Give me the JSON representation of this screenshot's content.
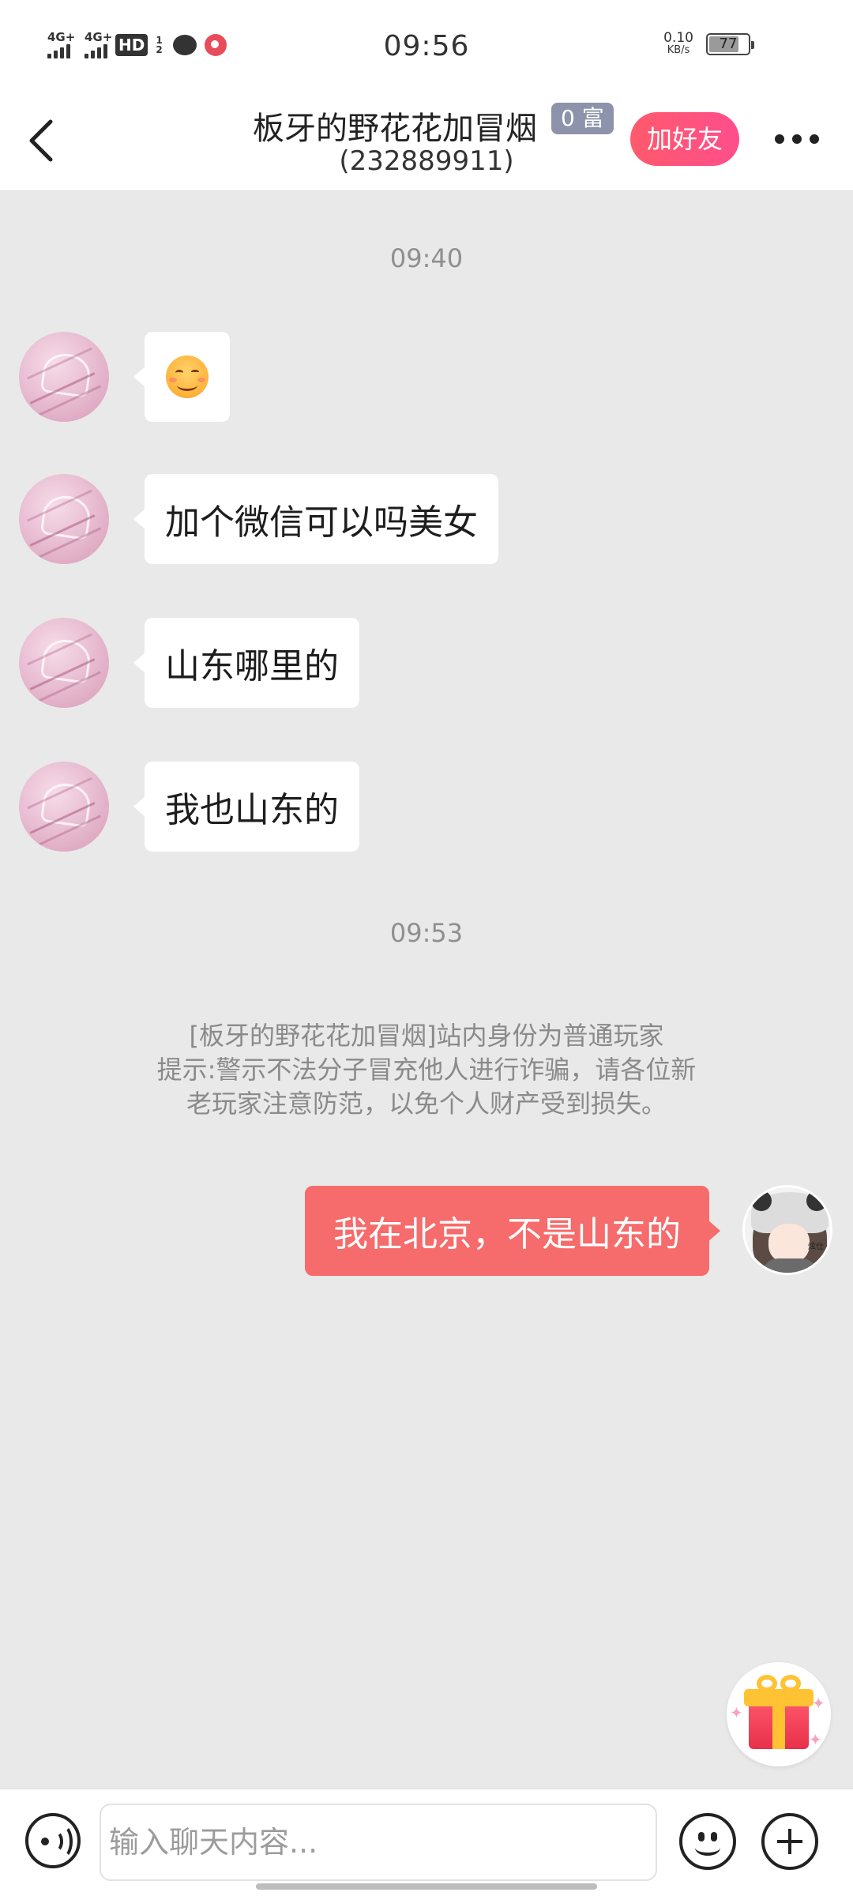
{
  "status_bar": {
    "time": "09:56",
    "network_1": "4G+",
    "network_2": "4G+",
    "hd_label": "HD",
    "hd_sub": "1 2",
    "speed_value": "0.10",
    "speed_unit": "KB/s",
    "battery": "77",
    "icons": [
      "signal-icon",
      "signal-icon",
      "hd-icon",
      "message-icon",
      "app-notification-icon",
      "battery-icon"
    ]
  },
  "header": {
    "title": "板牙的野花花加冒烟",
    "subtitle": "(232889911)",
    "badge": "0 富",
    "add_friend": "加好友",
    "back_icon": "back-arrow-icon",
    "more_icon": "more-dots-icon"
  },
  "chat": {
    "timestamps": [
      "09:40",
      "09:53"
    ],
    "incoming": [
      {
        "type": "emoji",
        "emoji_name": "smiling-face-emoji"
      },
      {
        "type": "text",
        "text": "加个微信可以吗美女"
      },
      {
        "type": "text",
        "text": "山东哪里的"
      },
      {
        "type": "text",
        "text": "我也山东的"
      }
    ],
    "system_notice": {
      "line1": "[板牙的野花花加冒烟]站内身份为普通玩家",
      "line2": "提示:警示不法分子冒充他人进行诈骗，请各位新",
      "line3": "老玩家注意防范，以免个人财产受到损失。"
    },
    "outgoing": [
      {
        "type": "text",
        "text": "我在北京，不是山东的"
      }
    ],
    "my_avatar_tag": "炫仕"
  },
  "input_bar": {
    "placeholder": "输入聊天内容...",
    "voice_icon": "voice-icon",
    "emoji_icon": "emoji-icon",
    "plus_icon": "plus-icon"
  },
  "gift": {
    "icon": "gift-icon"
  },
  "colors": {
    "background": "#e9e9e9",
    "outgoing_bubble": "#f66b6b",
    "add_friend_button": "#ff5a6c",
    "badge": "#8d93aa"
  }
}
